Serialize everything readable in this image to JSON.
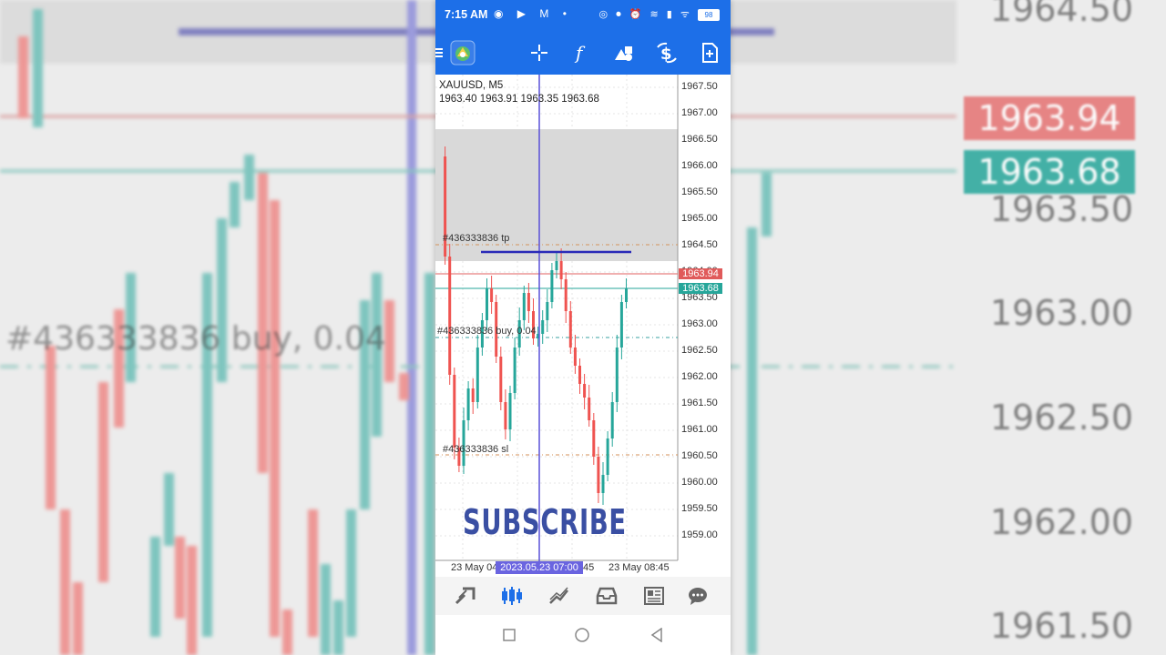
{
  "statusbar": {
    "time": "7:15 AM",
    "battery": "98"
  },
  "chart": {
    "symbol": "XAUUSD, M5",
    "ohlc": "1963.40 1963.91 1963.35 1963.68",
    "price_axis": [
      "1967.50",
      "1967.00",
      "1966.50",
      "1966.00",
      "1965.50",
      "1965.00",
      "1964.50",
      "1964.00",
      "1963.50",
      "1963.00",
      "1962.50",
      "1962.00",
      "1961.50",
      "1961.00",
      "1960.50",
      "1960.00",
      "1959.50",
      "1959.00"
    ],
    "ask_price": "1963.94",
    "bid_price": "1963.68",
    "order_tp_label": "#436333836 tp",
    "order_buy_label": "#436333836 buy, 0.04",
    "order_sl_label": "#436333836 sl",
    "time_labels": [
      "23 May 04",
      "45",
      "23 May 08:45"
    ],
    "time_cursor": "2023.05.23 07:00",
    "colors": {
      "bull": "#26a69a",
      "bear": "#ef5350",
      "cursor": "#6a64e0",
      "accent": "#1d6fe8"
    }
  },
  "overlay": {
    "subscribe": "SUBSCRIBE"
  },
  "background": {
    "prices": [
      "1964.50",
      "1963.50",
      "1963.00",
      "1962.50",
      "1962.00",
      "1961.50"
    ],
    "badge_ask": "1963.94",
    "badge_bid": "1963.68",
    "order_text": "#436333836 buy, 0.04"
  },
  "toolbar": {
    "icons": [
      "menu-icon",
      "app-logo-icon",
      "crosshair-icon",
      "indicators-icon",
      "objects-icon",
      "timeframe-icon",
      "new-order-icon"
    ]
  },
  "bottomnav": {
    "icons": [
      "quotes-icon",
      "chart-icon",
      "trade-icon",
      "history-icon",
      "news-icon",
      "messages-icon"
    ]
  }
}
